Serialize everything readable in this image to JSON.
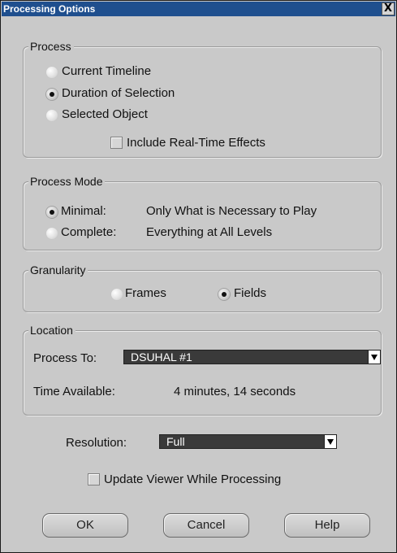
{
  "window": {
    "title": "Processing Options",
    "close_glyph": "X"
  },
  "process": {
    "legend": "Process",
    "options": [
      {
        "label": "Current Timeline",
        "selected": false
      },
      {
        "label": "Duration of Selection",
        "selected": true
      },
      {
        "label": "Selected Object",
        "selected": false
      }
    ],
    "include_rt_label": "Include Real-Time Effects",
    "include_rt_checked": false
  },
  "process_mode": {
    "legend": "Process Mode",
    "options": [
      {
        "label": "Minimal:",
        "description": "Only What is Necessary to Play",
        "selected": true
      },
      {
        "label": "Complete:",
        "description": "Everything at All Levels",
        "selected": false
      }
    ]
  },
  "granularity": {
    "legend": "Granularity",
    "options": [
      {
        "label": "Frames",
        "selected": false
      },
      {
        "label": "Fields",
        "selected": true
      }
    ]
  },
  "location": {
    "legend": "Location",
    "process_to_label": "Process To:",
    "process_to_value": "DSUHAL #1",
    "time_available_label": "Time Available:",
    "time_available_value": "4 minutes, 14 seconds"
  },
  "resolution": {
    "label": "Resolution:",
    "value": "Full"
  },
  "update_viewer": {
    "label": "Update Viewer While Processing",
    "checked": false
  },
  "buttons": {
    "ok": "OK",
    "cancel": "Cancel",
    "help": "Help"
  },
  "icons": {
    "close": "close-icon",
    "dropdown": "chevron-down-icon"
  }
}
